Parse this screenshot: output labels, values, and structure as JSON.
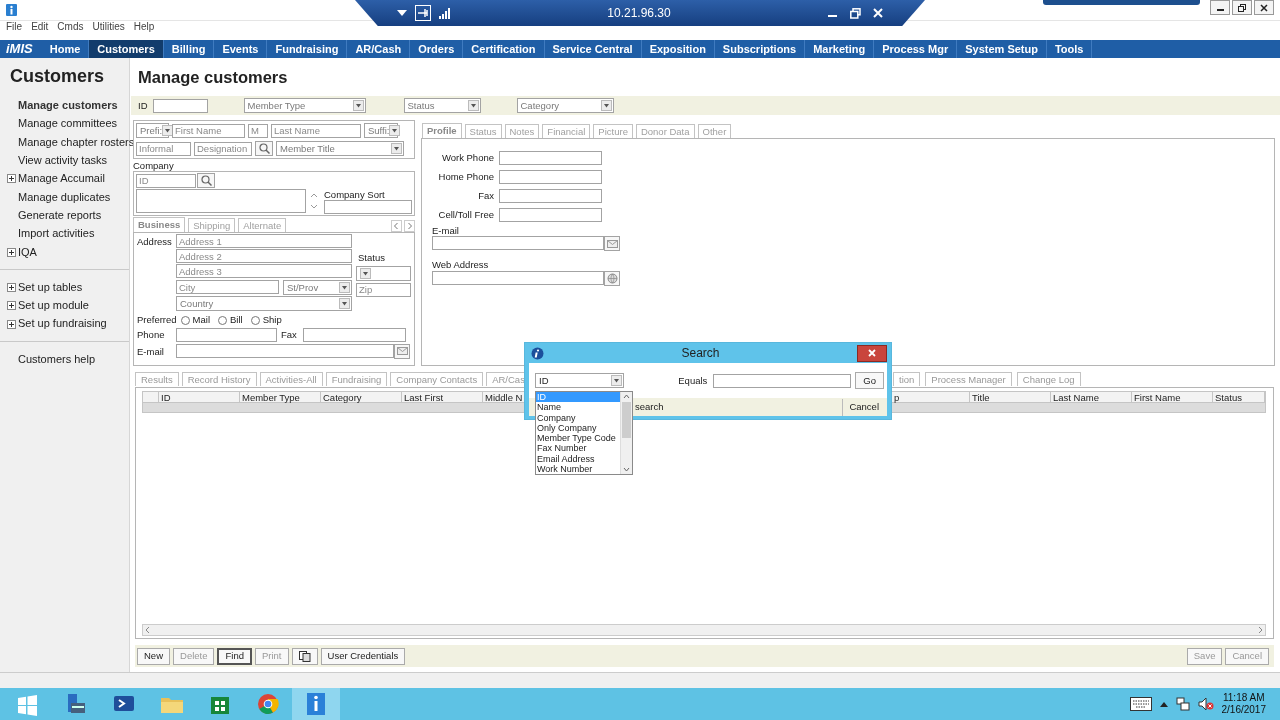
{
  "remote_bar": {
    "title": "10.21.96.30"
  },
  "menu_bar": [
    "File",
    "Edit",
    "Cmds",
    "Utilities",
    "Help"
  ],
  "nav": {
    "logo": "iMIS",
    "items": [
      {
        "label": "Home",
        "selected": false
      },
      {
        "label": "Customers",
        "selected": true
      },
      {
        "label": "Billing",
        "selected": false
      },
      {
        "label": "Events",
        "selected": false
      },
      {
        "label": "Fundraising",
        "selected": false
      },
      {
        "label": "AR/Cash",
        "selected": false
      },
      {
        "label": "Orders",
        "selected": false
      },
      {
        "label": "Certification",
        "selected": false
      },
      {
        "label": "Service Central",
        "selected": false
      },
      {
        "label": "Exposition",
        "selected": false
      },
      {
        "label": "Subscriptions",
        "selected": false
      },
      {
        "label": "Marketing",
        "selected": false
      },
      {
        "label": "Process Mgr",
        "selected": false
      },
      {
        "label": "System Setup",
        "selected": false
      },
      {
        "label": "Tools",
        "selected": false
      }
    ]
  },
  "sidebar": {
    "title": "Customers",
    "groups": [
      {
        "items": [
          {
            "label": "Manage customers",
            "selected": true,
            "expandable": false
          },
          {
            "label": "Manage committees",
            "selected": false,
            "expandable": false
          },
          {
            "label": "Manage chapter rosters",
            "selected": false,
            "expandable": false
          },
          {
            "label": "View activity tasks",
            "selected": false,
            "expandable": false
          },
          {
            "label": "Manage Accumail",
            "selected": false,
            "expandable": true
          },
          {
            "label": "Manage duplicates",
            "selected": false,
            "expandable": false
          },
          {
            "label": "Generate reports",
            "selected": false,
            "expandable": false
          },
          {
            "label": "Import activities",
            "selected": false,
            "expandable": false
          },
          {
            "label": "IQA",
            "selected": false,
            "expandable": true
          }
        ]
      },
      {
        "items": [
          {
            "label": "Set up tables",
            "selected": false,
            "expandable": true
          },
          {
            "label": "Set up module",
            "selected": false,
            "expandable": true
          },
          {
            "label": "Set up fundraising",
            "selected": false,
            "expandable": true
          }
        ]
      },
      {
        "items": [
          {
            "label": "Customers help",
            "selected": false,
            "expandable": false
          }
        ]
      }
    ]
  },
  "page_title": "Manage customers",
  "filter_bar": {
    "id_label": "ID",
    "dropdowns": [
      {
        "placeholder": "Member Type"
      },
      {
        "placeholder": "Status"
      },
      {
        "placeholder": "Category"
      }
    ]
  },
  "name_panel": {
    "row_1": [
      {
        "kind": "dropdown",
        "placeholder": "Prefi:"
      },
      {
        "kind": "input",
        "placeholder": "First Name"
      },
      {
        "kind": "input",
        "placeholder": "M"
      },
      {
        "kind": "input",
        "placeholder": "Last Name"
      },
      {
        "kind": "dropdown",
        "placeholder": "Suffi:"
      }
    ],
    "row_2": [
      {
        "kind": "input",
        "placeholder": "Informal"
      },
      {
        "kind": "input",
        "placeholder": "Designation"
      },
      {
        "kind": "search"
      },
      {
        "kind": "dropdown",
        "placeholder": "Member Title"
      }
    ],
    "company_label": "Company",
    "company_id": {
      "placeholder": "ID"
    },
    "company_sort_label": "Company Sort"
  },
  "address_panel": {
    "tabs": [
      {
        "label": "Business",
        "selected": true
      },
      {
        "label": "Shipping",
        "selected": false
      },
      {
        "label": "Alternate",
        "selected": false
      }
    ],
    "address_label": "Address",
    "lines": [
      {
        "placeholder": "Address 1"
      },
      {
        "placeholder": "Address 2"
      },
      {
        "placeholder": "Address 3"
      }
    ],
    "status_label": "Status",
    "city": {
      "placeholder": "City"
    },
    "state": {
      "placeholder": "St/Prov"
    },
    "zip": {
      "placeholder": "Zip"
    },
    "country": {
      "placeholder": "Country"
    },
    "preferred_label": "Preferred",
    "preferred": [
      {
        "label": "Mail",
        "selected": false
      },
      {
        "label": "Bill",
        "selected": false
      },
      {
        "label": "Ship",
        "selected": false
      }
    ],
    "phone_label": "Phone",
    "fax_label": "Fax",
    "email_label": "E-mail"
  },
  "profile_panel": {
    "tabs": [
      {
        "label": "Profile",
        "selected": true
      },
      {
        "label": "Status",
        "selected": false
      },
      {
        "label": "Notes",
        "selected": false
      },
      {
        "label": "Financial",
        "selected": false
      },
      {
        "label": "Picture",
        "selected": false
      },
      {
        "label": "Donor Data",
        "selected": false
      },
      {
        "label": "Other",
        "selected": false
      }
    ],
    "phones": [
      {
        "label": "Work Phone"
      },
      {
        "label": "Home Phone"
      },
      {
        "label": "Fax"
      },
      {
        "label": "Cell/Toll Free"
      }
    ],
    "email_label": "E-mail",
    "web_label": "Web Address"
  },
  "results": {
    "tabs": [
      {
        "label": "Results",
        "selected": false
      },
      {
        "label": "Record History",
        "selected": false
      },
      {
        "label": "Activities-All",
        "selected": false
      },
      {
        "label": "Fundraising",
        "selected": false
      },
      {
        "label": "Company Contacts",
        "selected": false
      },
      {
        "label": "AR/Cas",
        "selected": false
      },
      {
        "label": "tion",
        "selected": false
      },
      {
        "label": "Process Manager",
        "selected": false
      },
      {
        "label": "Change Log",
        "selected": false
      }
    ],
    "columns": [
      "ID",
      "Member Type",
      "Category",
      "Last First",
      "Middle N",
      "p",
      "Title",
      "Last Name",
      "First Name",
      "Status"
    ]
  },
  "buttons": [
    {
      "kind": "text",
      "label": "New",
      "disabled": false,
      "default": false
    },
    {
      "kind": "text",
      "label": "Delete",
      "disabled": true,
      "default": false
    },
    {
      "kind": "text",
      "label": "Find",
      "disabled": false,
      "default": true
    },
    {
      "kind": "text",
      "label": "Print",
      "disabled": true,
      "default": false
    },
    {
      "kind": "icon",
      "disabled": false,
      "default": false
    },
    {
      "kind": "text",
      "label": "User Credentials",
      "disabled": false,
      "default": false
    }
  ],
  "right_buttons": [
    {
      "label": "Save",
      "disabled": true
    },
    {
      "label": "Cancel",
      "disabled": true
    }
  ],
  "search_dialog": {
    "title": "Search",
    "field": {
      "value": "ID"
    },
    "operator": "Equals",
    "go": "Go",
    "hint": "search",
    "cancel": "Cancel",
    "options": [
      {
        "label": "ID",
        "selected": true
      },
      {
        "label": "Name",
        "selected": false
      },
      {
        "label": "Company",
        "selected": false
      },
      {
        "label": "Only Company",
        "selected": false
      },
      {
        "label": "Member Type Code",
        "selected": false
      },
      {
        "label": "Fax Number",
        "selected": false
      },
      {
        "label": "Email Address",
        "selected": false
      },
      {
        "label": "Work Number",
        "selected": false
      }
    ]
  },
  "taskbar": {
    "time": "11:18 AM",
    "date": "2/16/2017"
  }
}
